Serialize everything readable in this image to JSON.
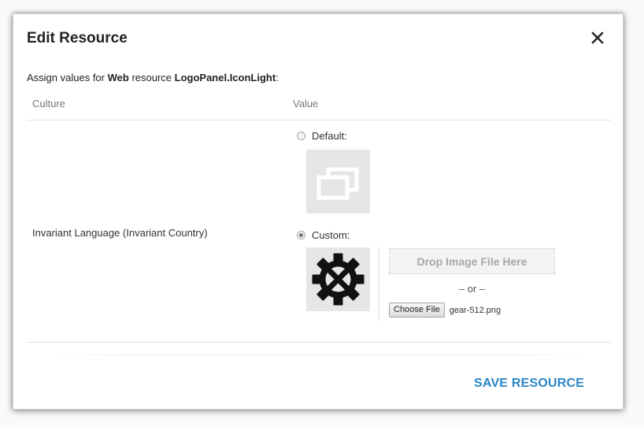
{
  "dialog": {
    "title": "Edit Resource",
    "close_label": "close",
    "assign": {
      "prefix": "Assign values for ",
      "resource_type": "Web",
      "middle": " resource ",
      "resource_name": "LogoPanel.IconLight",
      "suffix": ":"
    },
    "table": {
      "headers": [
        "Culture",
        "Value"
      ],
      "row": {
        "culture": "Invariant Language (Invariant Country)",
        "default_label": "Default:",
        "default_selected": false,
        "default_icon": "window-stack-icon",
        "custom_label": "Custom:",
        "custom_selected": true,
        "custom_icon": "gear-icon",
        "upload": {
          "drop_label": "Drop Image File Here",
          "or_label": "– or –",
          "choose_label": "Choose File",
          "file_name": "gear-512.png"
        }
      }
    },
    "save_label": "SAVE RESOURCE"
  },
  "colors": {
    "accent": "#2a86c8",
    "thumb_bg": "#e6e6e6",
    "drop_text": "#a8a8a8"
  }
}
